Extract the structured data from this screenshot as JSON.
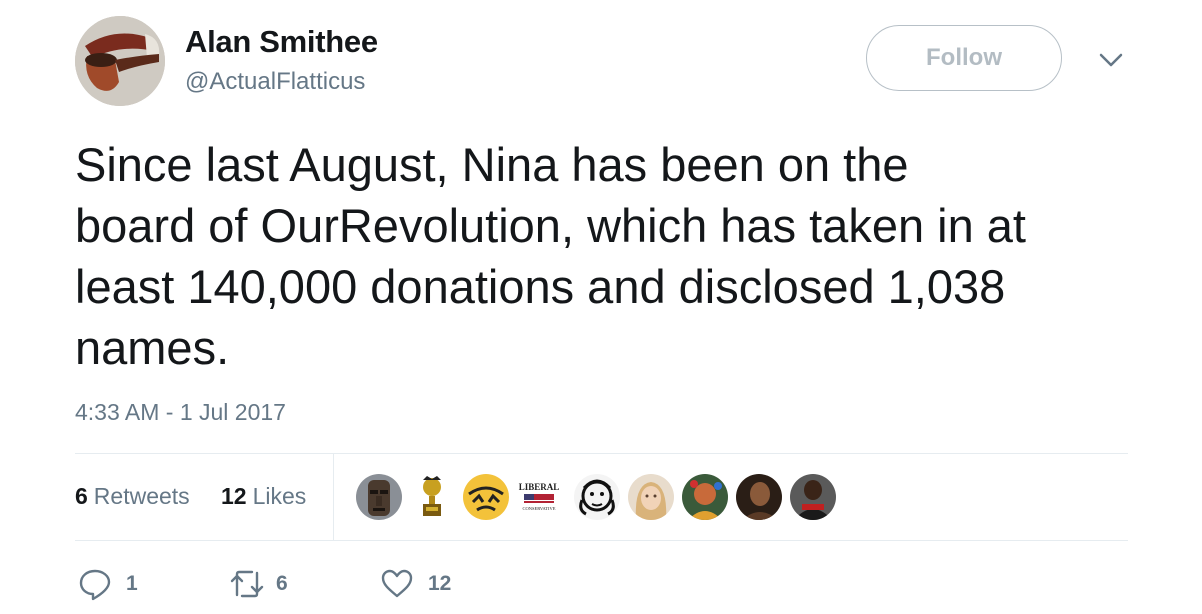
{
  "author": {
    "display_name": "Alan Smithee",
    "handle": "@ActualFlatticus",
    "avatar_icon": "pipe-icon"
  },
  "header": {
    "follow_label": "Follow",
    "menu_icon": "chevron-down-icon"
  },
  "tweet": {
    "lines": [
      "Since last August, Nina has been on the",
      "board of OurRevolution, which has taken in at",
      "least 140,000 donations and disclosed 1,038",
      "names."
    ],
    "timestamp": "4:33 AM - 1 Jul 2017"
  },
  "stats": {
    "retweets_count": "6",
    "retweets_label": "Retweets",
    "likes_count": "12",
    "likes_label": "Likes"
  },
  "likers": [
    {
      "icon": "moai-statue-avatar"
    },
    {
      "icon": "trophy-avatar"
    },
    {
      "icon": "cartoon-face-avatar"
    },
    {
      "icon": "liberal-conservative-logo-avatar",
      "text_top": "LIBERAL",
      "text_bottom": "CONSERVATIVE"
    },
    {
      "icon": "sketch-portrait-avatar"
    },
    {
      "icon": "woman-portrait-avatar"
    },
    {
      "icon": "colorful-art-avatar"
    },
    {
      "icon": "dark-portrait-avatar"
    },
    {
      "icon": "man-portrait-avatar"
    }
  ],
  "actions": {
    "reply_count": "1",
    "retweet_count": "6",
    "like_count": "12"
  },
  "colors": {
    "text": "#14171a",
    "secondary": "#657786",
    "border": "#e6ecf0"
  }
}
